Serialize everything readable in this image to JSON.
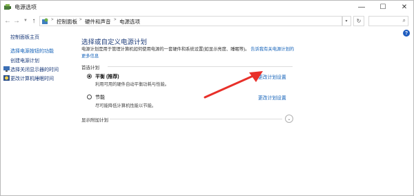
{
  "window": {
    "title": "电源选项",
    "icon": "power-options-icon",
    "controls": {
      "minimize": "—",
      "maximize": "☐",
      "close": "✕"
    }
  },
  "address_bar": {
    "crumbs": [
      "控制面板",
      "硬件和声音",
      "电源选项"
    ],
    "separator": ">",
    "search_placeholder": ""
  },
  "sidebar": {
    "items": [
      {
        "label": "控制面板主页",
        "icon": ""
      },
      {
        "label": "选择电源按钮的功能",
        "icon": ""
      },
      {
        "label": "创建电源计划",
        "icon": ""
      },
      {
        "label": "选择关闭显示器的时间",
        "icon": "display-icon"
      },
      {
        "label": "更改计算机睡眠时间",
        "icon": "moon-icon"
      }
    ]
  },
  "main": {
    "title": "选择或自定义电源计划",
    "description": "电源计划是用于管理计算机如何使用电源的一套硬件和系统设置(如显示亮度、睡眠等)。",
    "description_link": "告诉我有关电源计划的更多信息",
    "section_label": "首选计划",
    "plans": [
      {
        "name": "平衡 (推荐)",
        "desc": "利用可用的硬件自动平衡功耗与性能。",
        "link": "更改计划设置",
        "selected": true
      },
      {
        "name": "节能",
        "desc": "尽可能降低计算机性能以节能。",
        "link": "更改计划设置",
        "selected": false
      }
    ],
    "extra_label": "显示附加计划"
  },
  "colors": {
    "link": "#1160b8",
    "title": "#1f3d7a",
    "arrow": "#e8302a"
  }
}
